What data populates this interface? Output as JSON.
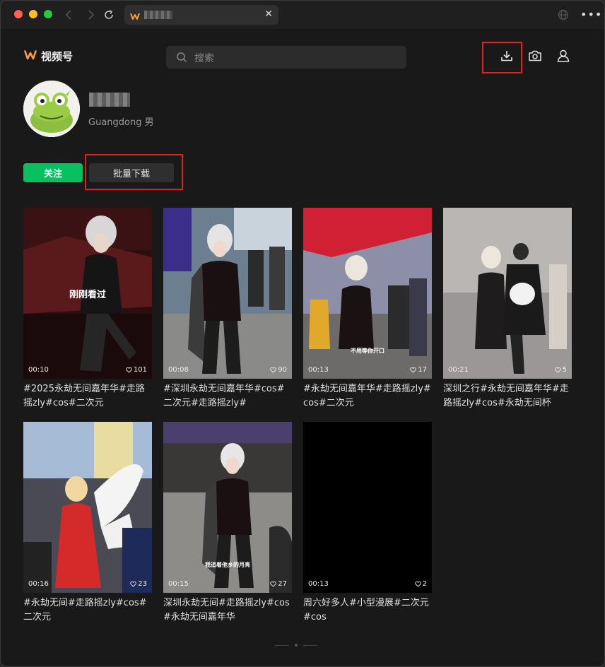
{
  "titlebar": {
    "tab_icon": "channels-logo-icon",
    "tab_title": "",
    "tab_close": "✕",
    "more_label": "•••"
  },
  "header": {
    "brand_name": "视频号",
    "search_placeholder": "搜索",
    "icons": [
      "download-icon",
      "camera-icon",
      "user-icon"
    ]
  },
  "profile": {
    "username": "",
    "location": "Guangdong 男",
    "follow_label": "关注",
    "batch_download_label": "批量下载"
  },
  "videos": [
    {
      "duration": "00:10",
      "likes": "101",
      "caption": "#2025永劫无间嘉年华#走路摇zly#cos#二次元",
      "overlay": "刚刚看过",
      "subtitle": ""
    },
    {
      "duration": "00:08",
      "likes": "90",
      "caption": "#深圳永劫无间嘉年华#cos#二次元#走路摇zly#",
      "overlay": "",
      "subtitle": ""
    },
    {
      "duration": "00:13",
      "likes": "17",
      "caption": "#永劫无间嘉年华#走路摇zly#cos#二次元",
      "overlay": "",
      "subtitle": "不用等你开口"
    },
    {
      "duration": "00:21",
      "likes": "5",
      "caption": "深圳之行#永劫无间嘉年华#走路摇zly#cos#永劫无间杯",
      "overlay": "",
      "subtitle": ""
    },
    {
      "duration": "00:16",
      "likes": "23",
      "caption": "#永劫无间#走路摇zly#cos#二次元",
      "overlay": "",
      "subtitle": ""
    },
    {
      "duration": "00:15",
      "likes": "27",
      "caption": "深圳永劫无间#走路摇zly#cos#永劫无间嘉年华",
      "overlay": "",
      "subtitle": "我追着他乡的月亮"
    },
    {
      "duration": "00:13",
      "likes": "2",
      "caption": "周六好多人#小型漫展#二次元#cos",
      "overlay": "",
      "subtitle": ""
    }
  ],
  "colors": {
    "accent_green": "#07c160",
    "highlight_red": "#e02020",
    "brand_orange": "#fa9d3b"
  }
}
